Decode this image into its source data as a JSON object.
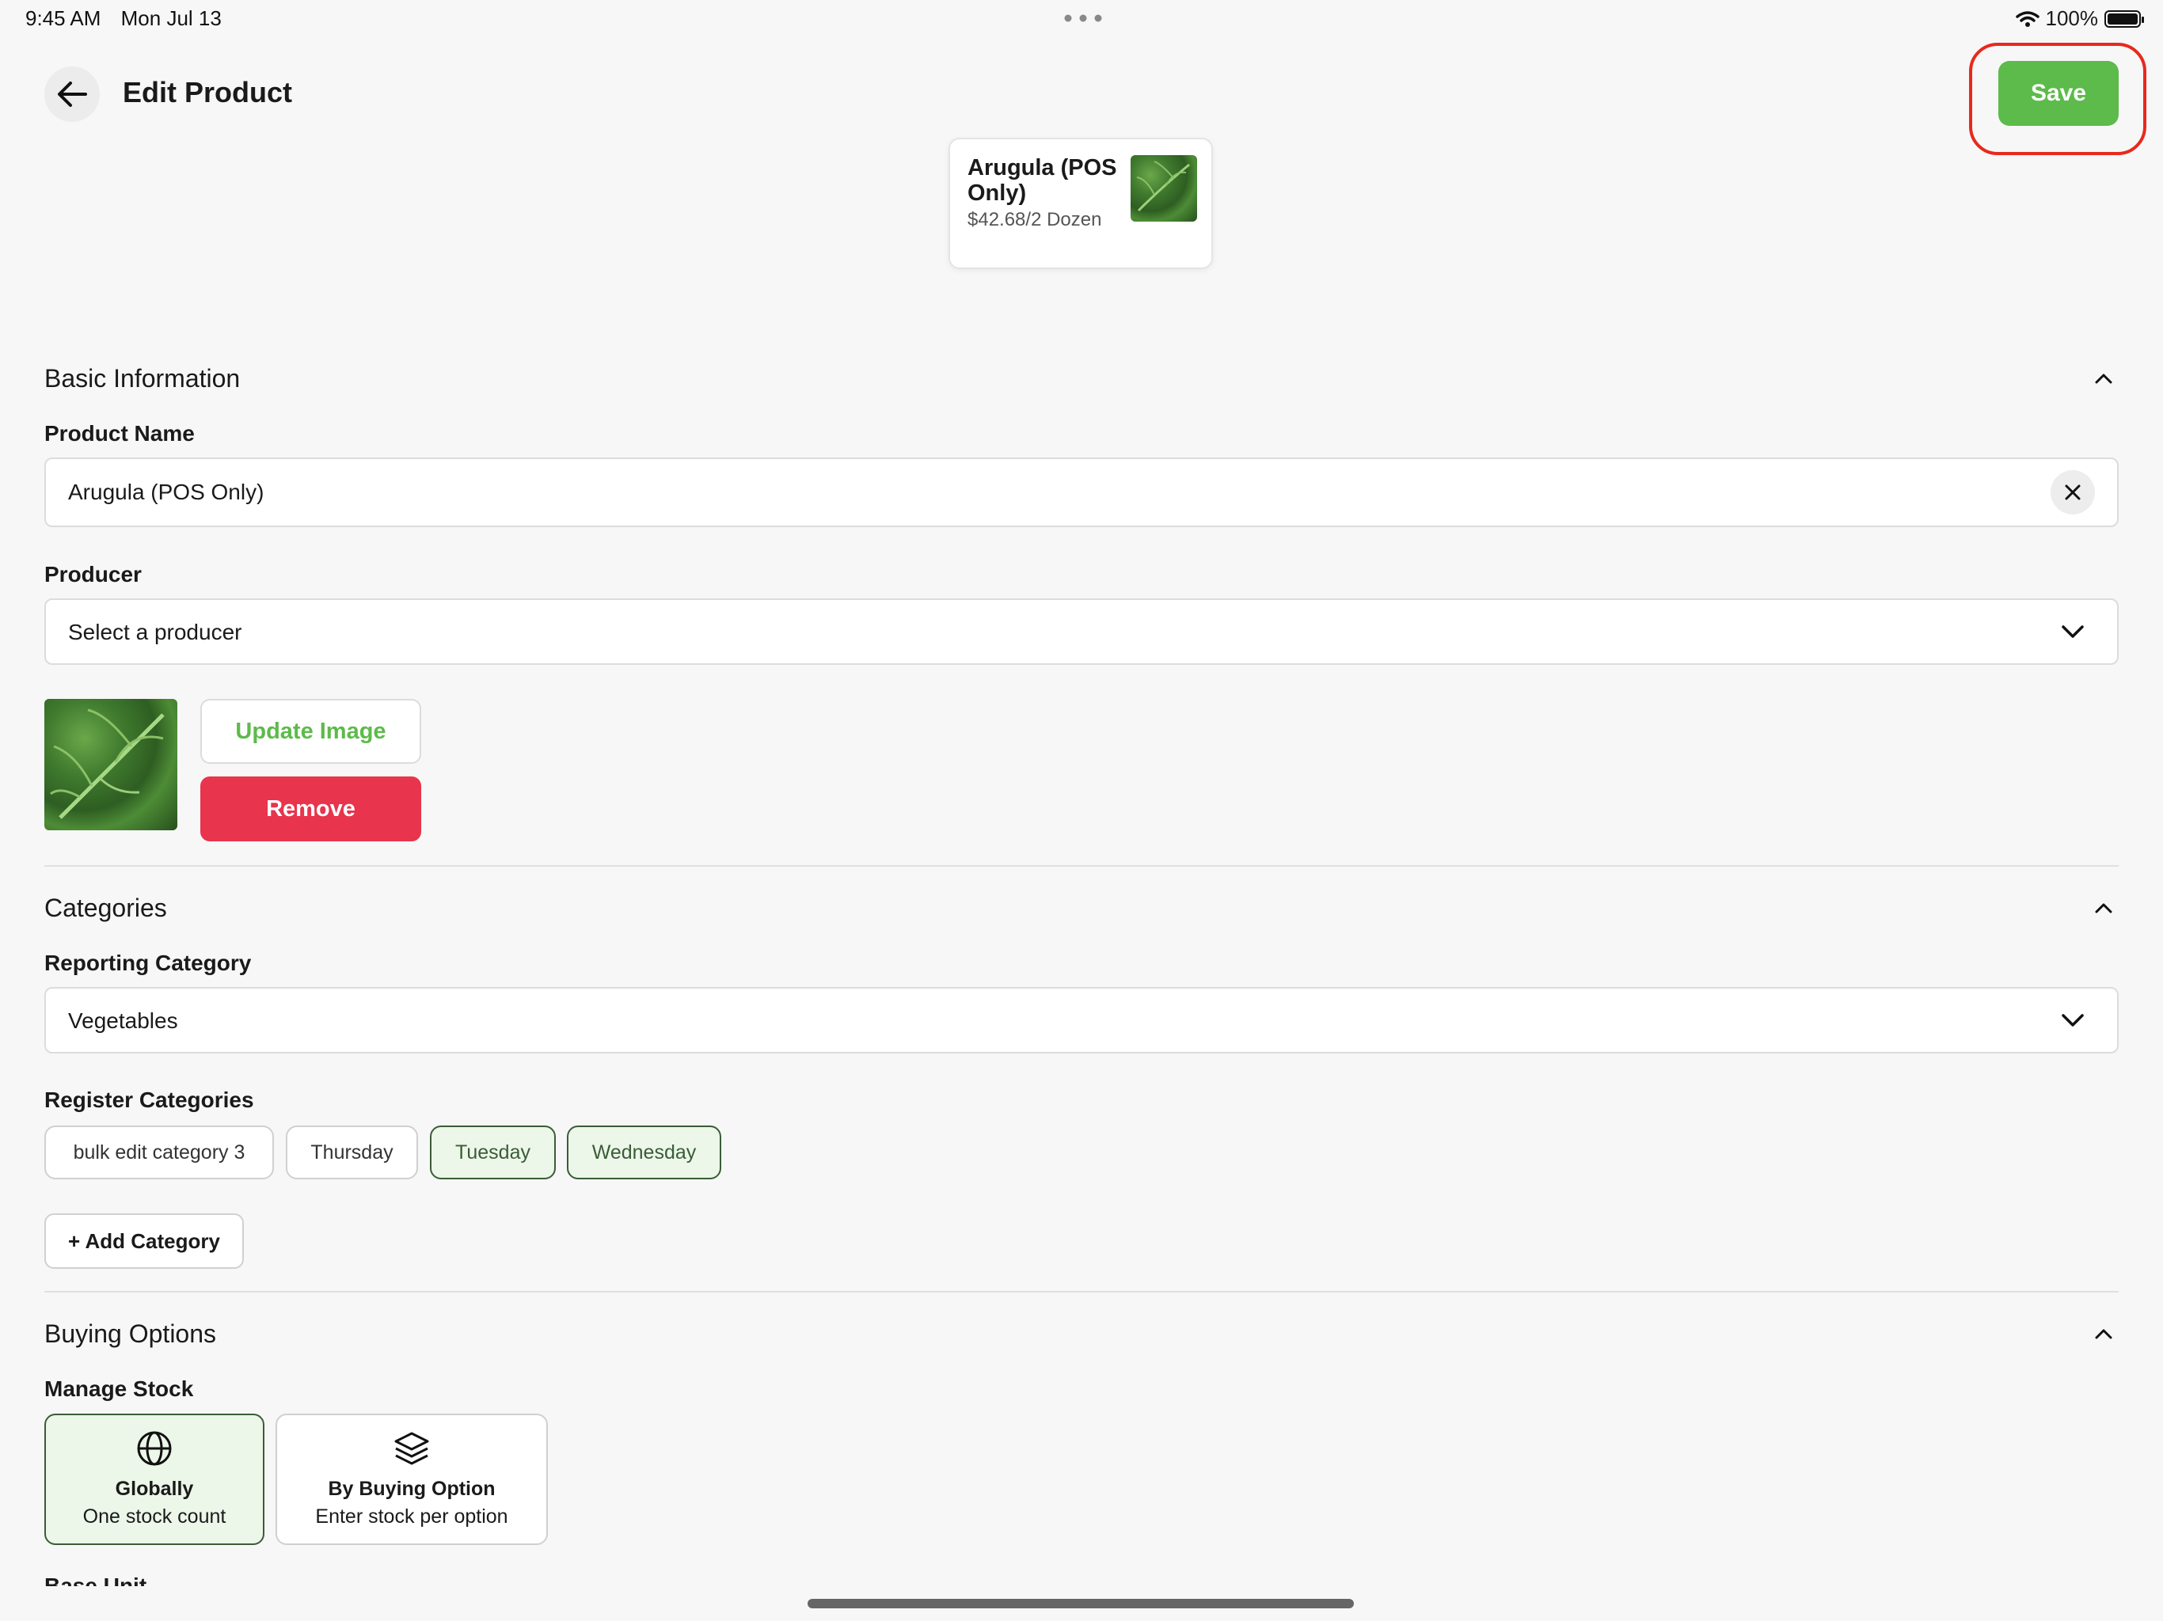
{
  "status_bar": {
    "time": "9:45 AM",
    "date": "Mon Jul 13",
    "battery": "100%"
  },
  "header": {
    "title": "Edit Product",
    "save_label": "Save"
  },
  "preview": {
    "name": "Arugula (POS Only)",
    "price": "$42.68/2 Dozen"
  },
  "basic_info": {
    "title": "Basic Information",
    "product_name_label": "Product Name",
    "product_name_value": "Arugula (POS Only)",
    "producer_label": "Producer",
    "producer_placeholder": "Select a producer",
    "update_image_label": "Update Image",
    "remove_label": "Remove"
  },
  "categories": {
    "title": "Categories",
    "reporting_label": "Reporting Category",
    "reporting_value": "Vegetables",
    "register_label": "Register Categories",
    "chips": [
      {
        "label": "bulk edit category 3",
        "selected": false
      },
      {
        "label": "Thursday",
        "selected": false
      },
      {
        "label": "Tuesday",
        "selected": true
      },
      {
        "label": "Wednesday",
        "selected": true
      }
    ],
    "add_label": "+ Add Category"
  },
  "buying_options": {
    "title": "Buying Options",
    "manage_stock_label": "Manage Stock",
    "options": [
      {
        "title": "Globally",
        "subtitle": "One stock count",
        "icon": "globe-icon",
        "selected": true
      },
      {
        "title": "By Buying Option",
        "subtitle": "Enter stock per option",
        "icon": "layers-icon",
        "selected": false
      }
    ],
    "next_label": "Base Unit"
  },
  "colors": {
    "accent_green": "#5cbb4a",
    "remove_red": "#e8344c",
    "highlight_ring": "#e8291c",
    "selected_chip": "#3a5d36"
  }
}
